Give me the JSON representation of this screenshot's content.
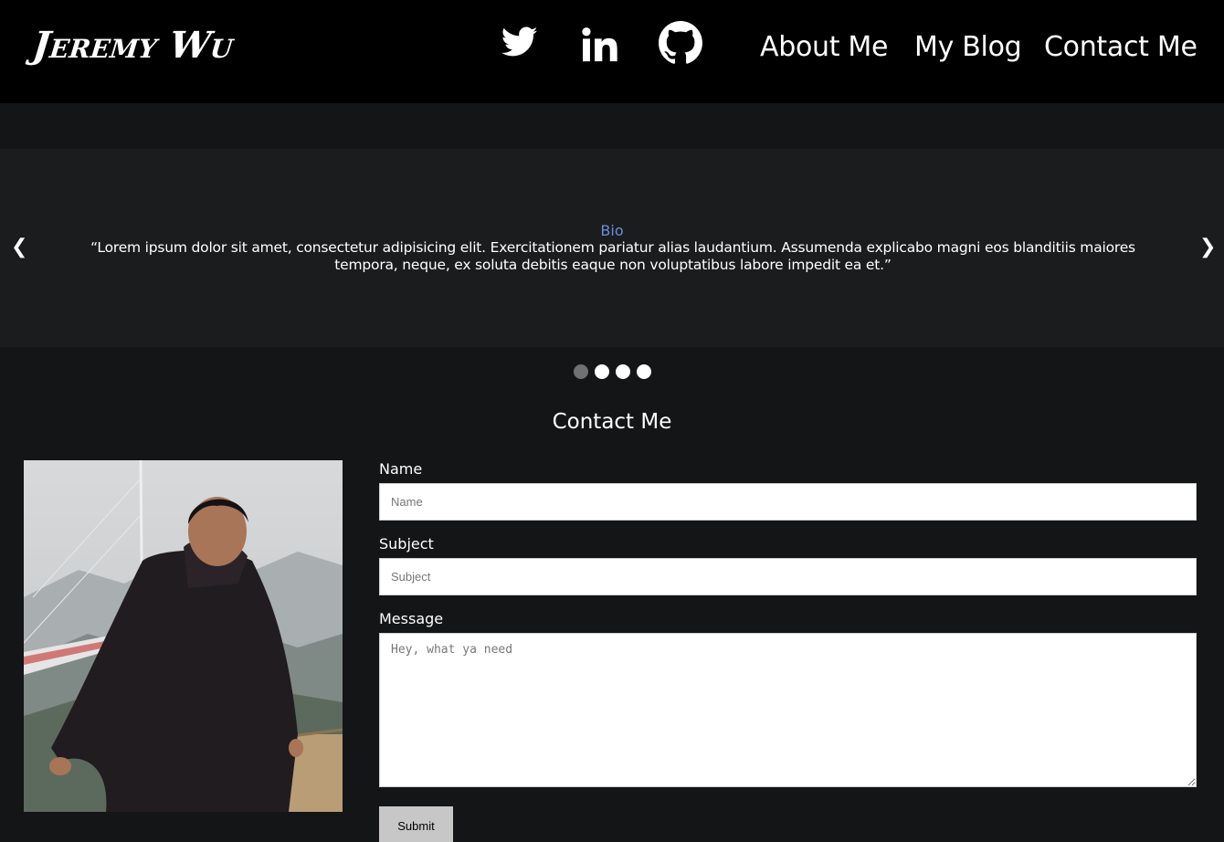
{
  "header": {
    "logo": "Jeremy Wu",
    "nav": {
      "about": "About Me",
      "blog": "My Blog",
      "contact": "Contact Me"
    }
  },
  "carousel": {
    "slide_title": "Bio",
    "slide_text": "“Lorem ipsum dolor sit amet, consectetur adipisicing elit. Exercitationem pariatur alias laudantium. Assumenda explicabo magni eos blanditiis maiores tempora, neque, ex soluta debitis eaque non voluptatibus labore impedit ea et.”",
    "prev_arrow": "❮",
    "next_arrow": "❯",
    "active_dot": 1
  },
  "contact": {
    "heading": "Contact Me",
    "name_label": "Name",
    "name_placeholder": "Name",
    "subject_label": "Subject",
    "subject_placeholder": "Subject",
    "message_label": "Message",
    "message_placeholder": "Hey, what ya need",
    "submit_label": "Submit"
  },
  "colors": {
    "header_bg": "#000000",
    "page_bg": "#141516",
    "carousel_bg": "#1b1c1e",
    "accent": "#6b8de0",
    "button_bg": "#c7c7c7"
  },
  "icons": [
    "twitter-icon",
    "linkedin-icon",
    "github-icon"
  ]
}
